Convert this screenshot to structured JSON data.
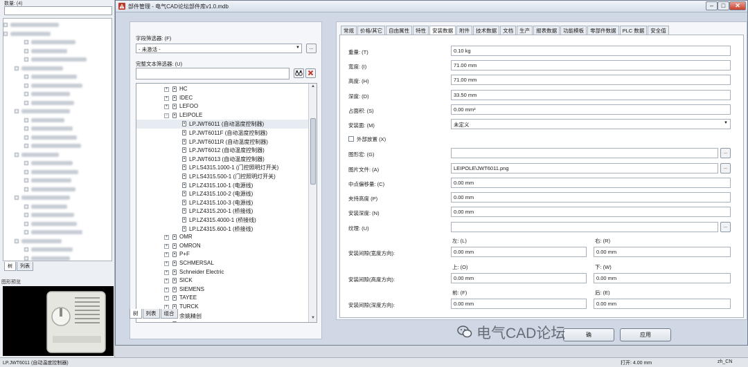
{
  "background": {
    "header_label": "数量: (4)",
    "tabs": [
      "树",
      "列表"
    ],
    "preview_title": "图形预览"
  },
  "statusbar": {
    "left_text": "LP.JWT6011 (自动温度控制器)",
    "open_text": "打开: 4.00 mm",
    "locale": "zh_CN"
  },
  "dialog": {
    "title": "部件管理 - 电气CAD论坛部件库v1.0.mdb",
    "window_buttons": {
      "minimize": "–",
      "maximize": "□",
      "close": "✕"
    }
  },
  "left_panel": {
    "field_filter_label": "字段筛选器: (F)",
    "field_filter_value": "- 未激活 -",
    "field_filter_more": "...",
    "fulltext_label": "完整文本筛选器: (U)",
    "fulltext_value": "",
    "tree": [
      {
        "text": "HC",
        "expander": "+",
        "level": 0
      },
      {
        "text": "IDEC",
        "expander": "+",
        "level": 0
      },
      {
        "text": "LEFOO",
        "expander": "+",
        "level": 0
      },
      {
        "text": "LEIPOLE",
        "expander": "−",
        "level": 0
      },
      {
        "text": "LP.JWT6011 (自动温度控制器)",
        "expander": "",
        "level": 1,
        "selected": true
      },
      {
        "text": "LP.JWT6011F (自动温度控制器)",
        "expander": "",
        "level": 1
      },
      {
        "text": "LP.JWT6011R (自动温度控制器)",
        "expander": "",
        "level": 1
      },
      {
        "text": "LP.JWT6012 (自动温度控制器)",
        "expander": "",
        "level": 1
      },
      {
        "text": "LP.JWT6013 (自动温度控制器)",
        "expander": "",
        "level": 1
      },
      {
        "text": "LP.LS4315.1000-1 (门控照明灯开关)",
        "expander": "",
        "level": 1
      },
      {
        "text": "LP.LS4315.500-1 (门控照明灯开关)",
        "expander": "",
        "level": 1
      },
      {
        "text": "LP.LZ4315.100-1 (电源线)",
        "expander": "",
        "level": 1
      },
      {
        "text": "LP.LZ4315.100-2 (电源线)",
        "expander": "",
        "level": 1
      },
      {
        "text": "LP.LZ4315.100-3 (电源线)",
        "expander": "",
        "level": 1
      },
      {
        "text": "LP.LZ4315.200-1 (桥接线)",
        "expander": "",
        "level": 1
      },
      {
        "text": "LP.LZ4315.4000-1 (桥接线)",
        "expander": "",
        "level": 1
      },
      {
        "text": "LP.LZ4315.600-1 (桥接线)",
        "expander": "",
        "level": 1
      },
      {
        "text": "OMR",
        "expander": "+",
        "level": 0
      },
      {
        "text": "OMRON",
        "expander": "+",
        "level": 0
      },
      {
        "text": "P+F",
        "expander": "+",
        "level": 0
      },
      {
        "text": "SCHMERSAL",
        "expander": "+",
        "level": 0
      },
      {
        "text": "Schneider Electric",
        "expander": "+",
        "level": 0
      },
      {
        "text": "SICK",
        "expander": "+",
        "level": 0
      },
      {
        "text": "SIEMENS",
        "expander": "+",
        "level": 0
      },
      {
        "text": "TAYEE",
        "expander": "+",
        "level": 0
      },
      {
        "text": "TURCK",
        "expander": "+",
        "level": 0
      },
      {
        "text": "余姚精创",
        "expander": "+",
        "level": 0
      },
      {
        "text": "...",
        "expander": "+",
        "level": 0
      }
    ],
    "tabs": [
      {
        "label": "树",
        "active": true
      },
      {
        "label": "列表",
        "active": false
      },
      {
        "label": "组合",
        "active": false
      }
    ]
  },
  "right_panel": {
    "tabs": [
      {
        "label": "常规",
        "active": false
      },
      {
        "label": "价格/其它",
        "active": false
      },
      {
        "label": "自由属性",
        "active": false
      },
      {
        "label": "特性",
        "active": false
      },
      {
        "label": "安装数据",
        "active": true
      },
      {
        "label": "附件",
        "active": false
      },
      {
        "label": "技术数据",
        "active": false
      },
      {
        "label": "文档",
        "active": false
      },
      {
        "label": "生产",
        "active": false
      },
      {
        "label": "报表数据",
        "active": false
      },
      {
        "label": "功能模板",
        "active": false
      },
      {
        "label": "零部件数据",
        "active": false
      },
      {
        "label": "PLC 数据",
        "active": false
      },
      {
        "label": "安全值",
        "active": false
      }
    ],
    "fields": {
      "weight": {
        "label": "重量: (T)",
        "value": "0.10 kg"
      },
      "width": {
        "label": "宽度: (I)",
        "value": "71.00 mm"
      },
      "height": {
        "label": "高度: (H)",
        "value": "71.00 mm"
      },
      "depth": {
        "label": "深度: (D)",
        "value": "33.50 mm"
      },
      "area": {
        "label": "占面积: (S)",
        "value": "0.00 mm²"
      },
      "mount_surface": {
        "label": "安装面: (M)",
        "value": "未定义"
      },
      "external_placement": {
        "label": "外部放置 (X)"
      },
      "graphic_macro": {
        "label": "图形宏: (G)",
        "value": ""
      },
      "image_file": {
        "label": "图片文件: (A)",
        "value": "LEIPOLE\\JWT6011.png"
      },
      "center_offset": {
        "label": "中点偏移量: (C)",
        "value": "0.00 mm"
      },
      "clamp_height": {
        "label": "夹持高度 (P)",
        "value": "0.00 mm"
      },
      "mount_depth": {
        "label": "安装深度: (N)",
        "value": "0.00 mm"
      },
      "texture": {
        "label": "纹理: (U)",
        "value": ""
      }
    },
    "clearance": {
      "left_label": "左: (L)",
      "right_label": "右: (R)",
      "top_label": "上: (O)",
      "bottom_label": "下: (W)",
      "front_label": "前: (F)",
      "back_label": "后: (E)",
      "width_dir_label": "安装间隙(宽度方向):",
      "height_dir_label": "安装间隙(高度方向):",
      "depth_dir_label": "安装间隙(深度方向):",
      "left_value": "0.00 mm",
      "right_value": "0.00 mm",
      "top_value": "0.00 mm",
      "bottom_value": "0.00 mm",
      "front_value": "0.00 mm",
      "back_value": "0.00 mm"
    },
    "more_button": "..."
  },
  "bottom_buttons": {
    "first": "确",
    "second": "应用"
  },
  "watermark": "电气CAD论坛"
}
